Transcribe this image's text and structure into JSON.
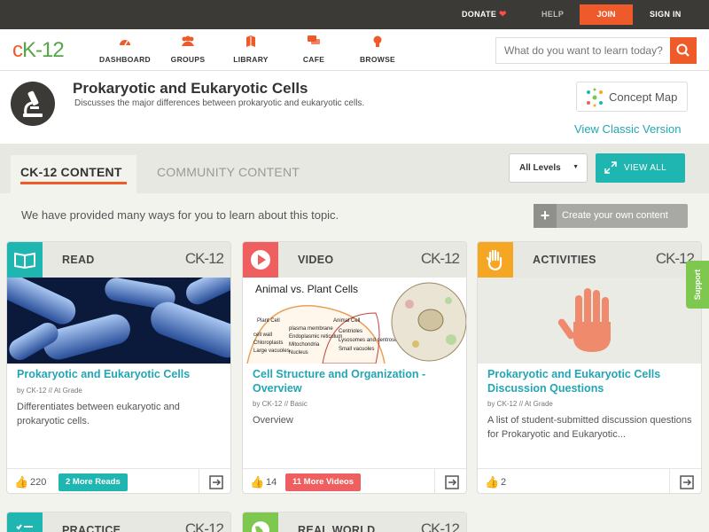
{
  "topbar": {
    "donate": "DONATE",
    "help": "HELP",
    "join": "JOIN",
    "signin": "SIGN IN"
  },
  "nav": {
    "logo": "CK-12",
    "items": [
      {
        "label": "DASHBOARD",
        "icon": "speedometer-icon"
      },
      {
        "label": "GROUPS",
        "icon": "groups-icon"
      },
      {
        "label": "LIBRARY",
        "icon": "library-icon"
      },
      {
        "label": "CAFE",
        "icon": "chat-icon"
      },
      {
        "label": "BROWSE",
        "icon": "lightbulb-icon"
      }
    ],
    "search_placeholder": "What do you want to learn today?"
  },
  "header": {
    "title": "Prokaryotic and Eukaryotic Cells",
    "subtitle": "Discusses the major differences between prokaryotic and eukaryotic cells.",
    "concept_map": "Concept Map",
    "classic": "View Classic Version"
  },
  "tabs": {
    "active": "CK-12 CONTENT",
    "community": "COMMUNITY CONTENT",
    "levels": "All Levels",
    "view_all": "VIEW ALL"
  },
  "intro": "We have provided many ways for you to learn about this topic.",
  "create": "Create your own content",
  "cards": [
    {
      "type": "READ",
      "brand": "CK-12",
      "color": "#1fb5b0",
      "name": "Prokaryotic and Eukaryotic Cells",
      "by": "by CK-12",
      "grade": "// At Grade",
      "desc": "Differentiates between eukaryotic and prokaryotic cells.",
      "likes": "220",
      "more": "2 More Reads"
    },
    {
      "type": "VIDEO",
      "brand": "CK-12",
      "color": "#f05f5f",
      "name": "Cell Structure and Organization - Overview",
      "by": "by CK-12",
      "grade": "// Basic",
      "desc": "Overview",
      "likes": "14",
      "more": "11 More Videos",
      "image_title": "Animal vs. Plant Cells",
      "image_labels": [
        "Plant Cell",
        "Animal Cell",
        "cell wall",
        "Chloroplasts",
        "Large vacuoles",
        "plasma membrane",
        "Endoplasmic reticulum",
        "Mitochondria",
        "Nucleus",
        "Centrioles",
        "Lysosomes and centrosomes",
        "Small vacuoles"
      ]
    },
    {
      "type": "ACTIVITIES",
      "brand": "CK-12",
      "color": "#f5a623",
      "name": "Prokaryotic and Eukaryotic Cells Discussion Questions",
      "by": "by CK-12",
      "grade": "// At Grade",
      "desc": "A list of student-submitted discussion questions for Prokaryotic and Eukaryotic...",
      "likes": "2"
    }
  ],
  "cards_bottom": [
    {
      "type": "PRACTICE",
      "brand": "CK-12",
      "color": "#1fb5b0"
    },
    {
      "type": "REAL WORLD",
      "brand": "CK-12",
      "color": "#7ec850"
    }
  ],
  "support": "Support"
}
